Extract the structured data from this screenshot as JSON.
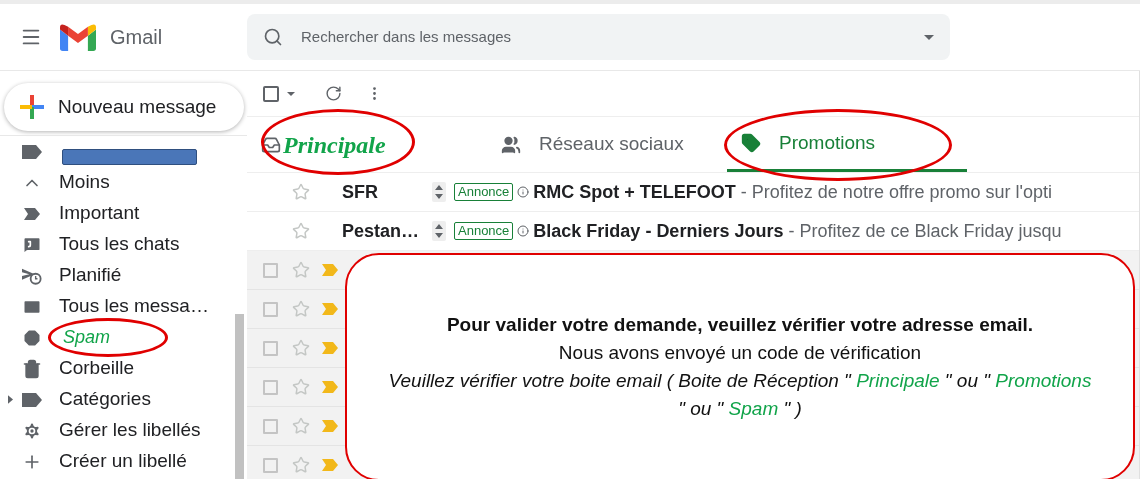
{
  "header": {
    "app_name": "Gmail",
    "search": {
      "placeholder": "Rechercher dans les messages"
    }
  },
  "sidebar": {
    "compose": "Nouveau message",
    "items": [
      {
        "kind": "redacted"
      },
      {
        "kind": "item",
        "label": "Moins"
      },
      {
        "kind": "item",
        "label": "Important"
      },
      {
        "kind": "item",
        "label": "Tous les chats"
      },
      {
        "kind": "item",
        "label": "Planifié"
      },
      {
        "kind": "item",
        "label": "Tous les messa…"
      },
      {
        "kind": "overlay_label",
        "label": "Spam",
        "annotated": true
      },
      {
        "kind": "item",
        "label": "Corbeille"
      },
      {
        "kind": "folder",
        "label": "Catégories"
      },
      {
        "kind": "item",
        "label": "Gérer les libellés"
      },
      {
        "kind": "item",
        "label": "Créer un libellé"
      }
    ]
  },
  "tabs": [
    {
      "kind": "overlay_label",
      "label": "Principale",
      "selected": false,
      "annotated": true
    },
    {
      "kind": "tab",
      "label": "Réseaux sociaux",
      "selected": false,
      "annotated": false
    },
    {
      "kind": "tab",
      "label": "Promotions",
      "selected": true,
      "annotated": true
    }
  ],
  "ads": [
    {
      "sender": "SFR",
      "badge": "Annonce",
      "subject": "RMC Spot + TELEFOOT",
      "snippet": "- Profitez de notre offre promo sur l'opti"
    },
    {
      "sender": "Pestan…",
      "badge": "Annonce",
      "subject": "Black Friday - Derniers Jours",
      "snippet": "- Profitez de ce Black Friday jusqu"
    }
  ],
  "toolbar": {
    "select_all_checked": false
  },
  "hidden_rows": [
    {
      "checked": false,
      "important": true
    },
    {
      "checked": false,
      "important": true
    },
    {
      "checked": false,
      "important": true
    },
    {
      "checked": false,
      "important": true
    },
    {
      "checked": false,
      "important": true
    },
    {
      "checked": false,
      "important": true
    }
  ],
  "callout": {
    "lines": [
      {
        "kind": "bold",
        "segments": [
          {
            "text": "Pour valider votre demande, veuillez vérifier votre adresse email.",
            "highlight": false
          }
        ]
      },
      {
        "kind": "normal",
        "segments": [
          {
            "text": "Nous avons envoyé un code de vérification",
            "highlight": false
          }
        ]
      },
      {
        "kind": "italic",
        "segments": [
          {
            "text": "Veuillez vérifier votre boite email ( Boite de Réception \" ",
            "highlight": false
          },
          {
            "text": "Principale",
            "highlight": true
          },
          {
            "text": " \" ou \" ",
            "highlight": false
          },
          {
            "text": "Promotions",
            "highlight": true
          },
          {
            "text": " \" ou \" ",
            "highlight": false
          },
          {
            "text": "Spam",
            "highlight": true
          },
          {
            "text": " \" )",
            "highlight": false
          }
        ]
      }
    ]
  }
}
